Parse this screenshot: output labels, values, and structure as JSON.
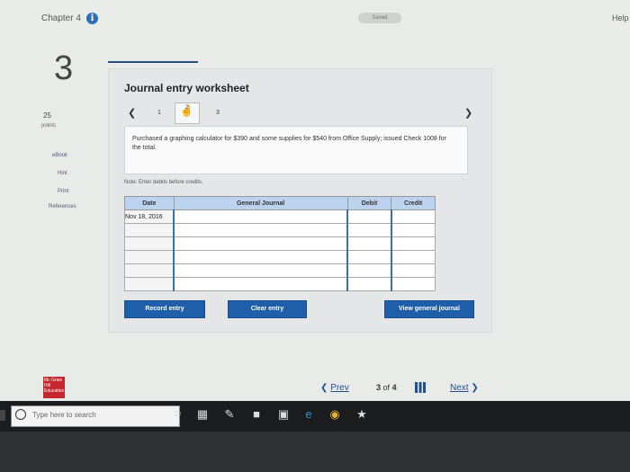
{
  "header": {
    "chapter": "Chapter 4",
    "saved": "Saved",
    "help": "Help"
  },
  "question": {
    "number": "3",
    "points_value": "25",
    "points_label": "points"
  },
  "side_links": [
    "eBook",
    "Hint",
    "Print",
    "References"
  ],
  "worksheet": {
    "title": "Journal entry worksheet",
    "tabs": [
      "1",
      "2",
      "3"
    ],
    "active_tab": "2",
    "description": "Purchased a graphing calculator for $390 and some supplies for $540 from Office Supply; issued Check 1008 for the total.",
    "note": "Note: Enter debits before credits.",
    "columns": [
      "Date",
      "General Journal",
      "Debit",
      "Credit"
    ],
    "rows": [
      {
        "date": "Nov 18, 2016",
        "account": "",
        "debit": "",
        "credit": ""
      },
      {
        "date": "",
        "account": "",
        "debit": "",
        "credit": ""
      },
      {
        "date": "",
        "account": "",
        "debit": "",
        "credit": ""
      },
      {
        "date": "",
        "account": "",
        "debit": "",
        "credit": ""
      },
      {
        "date": "",
        "account": "",
        "debit": "",
        "credit": ""
      },
      {
        "date": "",
        "account": "",
        "debit": "",
        "credit": ""
      }
    ],
    "buttons": {
      "record": "Record entry",
      "clear": "Clear entry",
      "view": "View general journal"
    }
  },
  "footer": {
    "logo": "Mc Graw Hill Education",
    "prev": "Prev",
    "page": "3",
    "of": "of",
    "total": "4",
    "next": "Next"
  },
  "taskbar": {
    "search_placeholder": "Type here to search"
  },
  "colors": {
    "button": "#1f5ea8",
    "header_row": "#bcd3ef",
    "logo": "#c4262e"
  }
}
